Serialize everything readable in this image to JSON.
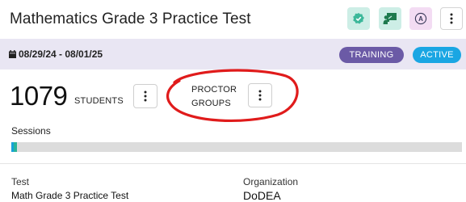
{
  "header": {
    "title": "Mathematics Grade 3 Practice Test",
    "buttons": [
      {
        "icon": "check-badge-icon",
        "color": "#2fae8e"
      },
      {
        "icon": "presentation-icon",
        "color": "#1e7a4e"
      },
      {
        "icon": "accommodation-icon",
        "label": "A"
      },
      {
        "icon": "kebab-icon"
      }
    ],
    "accommodation_letter": "A"
  },
  "date_bar": {
    "dates": "08/29/24 - 08/01/25",
    "badges": {
      "training": "TRAINING",
      "active": "ACTIVE"
    }
  },
  "stats": {
    "student_count": "1079",
    "students_label": "STUDENTS",
    "proctor_line1": "PROCTOR",
    "proctor_line2": "GROUPS"
  },
  "sessions": {
    "label": "Sessions",
    "progress": 0.013
  },
  "details": {
    "test_label": "Test",
    "test_value": "Math Grade 3 Practice Test",
    "org_label": "Organization",
    "org_value": "DoDEA"
  },
  "colors": {
    "accent": "#6b5aa6",
    "active": "#1aa6e3",
    "annotation": "#e01b1b"
  }
}
